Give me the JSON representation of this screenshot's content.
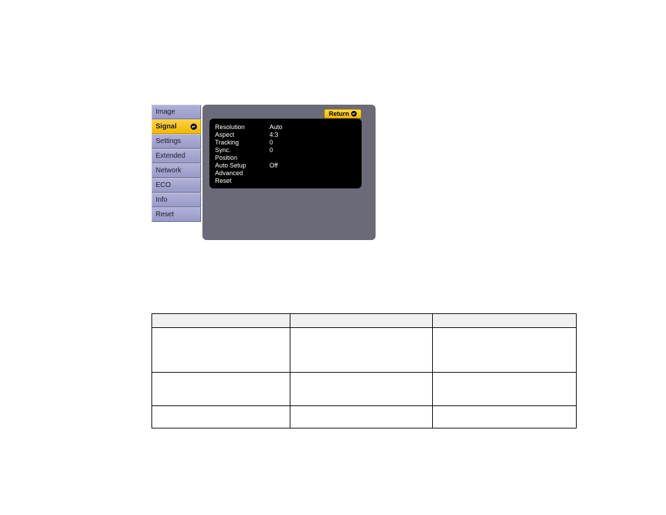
{
  "sidebar": {
    "items": [
      {
        "label": "Image"
      },
      {
        "label": "Signal"
      },
      {
        "label": "Settings"
      },
      {
        "label": "Extended"
      },
      {
        "label": "Network"
      },
      {
        "label": "ECO"
      },
      {
        "label": "Info"
      },
      {
        "label": "Reset"
      }
    ]
  },
  "return_label": "Return",
  "panel": {
    "rows": [
      {
        "label": "Resolution",
        "value": "Auto"
      },
      {
        "label": "Aspect",
        "value": "4:3"
      },
      {
        "label": "Tracking",
        "value": "0"
      },
      {
        "label": "Sync.",
        "value": "0"
      },
      {
        "label": "Position",
        "value": ""
      },
      {
        "label": "Auto Setup",
        "value": "Off"
      },
      {
        "label": "Advanced",
        "value": ""
      },
      {
        "label": "Reset",
        "value": ""
      }
    ]
  }
}
